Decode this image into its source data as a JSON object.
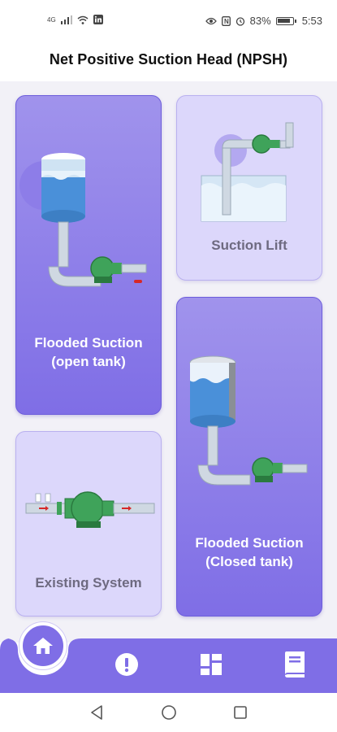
{
  "status_bar": {
    "network": "4G",
    "battery": "83%",
    "time": "5:53"
  },
  "header": {
    "title": "Net Positive Suction Head (NPSH)"
  },
  "cards": {
    "flooded_open": {
      "line1": "Flooded Suction",
      "line2": "(open tank)"
    },
    "suction_lift": {
      "label": "Suction Lift"
    },
    "flooded_closed": {
      "line1": "Flooded Suction",
      "line2": "(Closed tank)"
    },
    "existing_system": {
      "label": "Existing System"
    }
  },
  "bottom_nav": {
    "items": [
      "home-icon",
      "info-icon",
      "dashboard-icon",
      "book-icon"
    ]
  },
  "colors": {
    "accent": "#7f6ee6",
    "accent_light": "#dcd7fb",
    "pump_green": "#3fa35a",
    "pipe": "#cfd8e2"
  }
}
